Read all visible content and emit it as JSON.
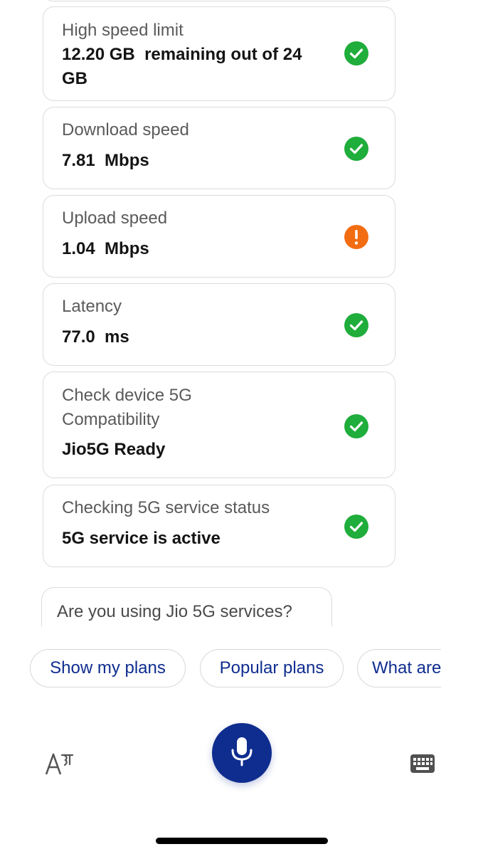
{
  "checks": [
    {
      "label": "High speed limit",
      "value": "12.20 GB  remaining out of 24 GB",
      "status": "ok"
    },
    {
      "label": "Download speed",
      "value": "7.81  Mbps",
      "status": "ok"
    },
    {
      "label": "Upload speed",
      "value": "1.04  Mbps",
      "status": "warning"
    },
    {
      "label": "Latency",
      "value": "77.0  ms",
      "status": "ok"
    },
    {
      "label": "Check device 5G Compatibility",
      "value": "Jio5G Ready",
      "status": "ok"
    },
    {
      "label": "Checking 5G service status",
      "value": "5G service is active",
      "status": "ok"
    }
  ],
  "chat": {
    "question": "Are you using Jio 5G services?"
  },
  "suggestions": [
    {
      "label": "Show my plans"
    },
    {
      "label": "Popular plans"
    },
    {
      "label": "What are"
    }
  ],
  "bottom_bar": {
    "lang_icon": "language-toggle-icon",
    "mic_icon": "microphone-icon",
    "keyboard_icon": "keyboard-icon"
  },
  "colors": {
    "ok": "#1fad3b",
    "warning": "#f26d12",
    "brand": "#0f2d8f"
  }
}
